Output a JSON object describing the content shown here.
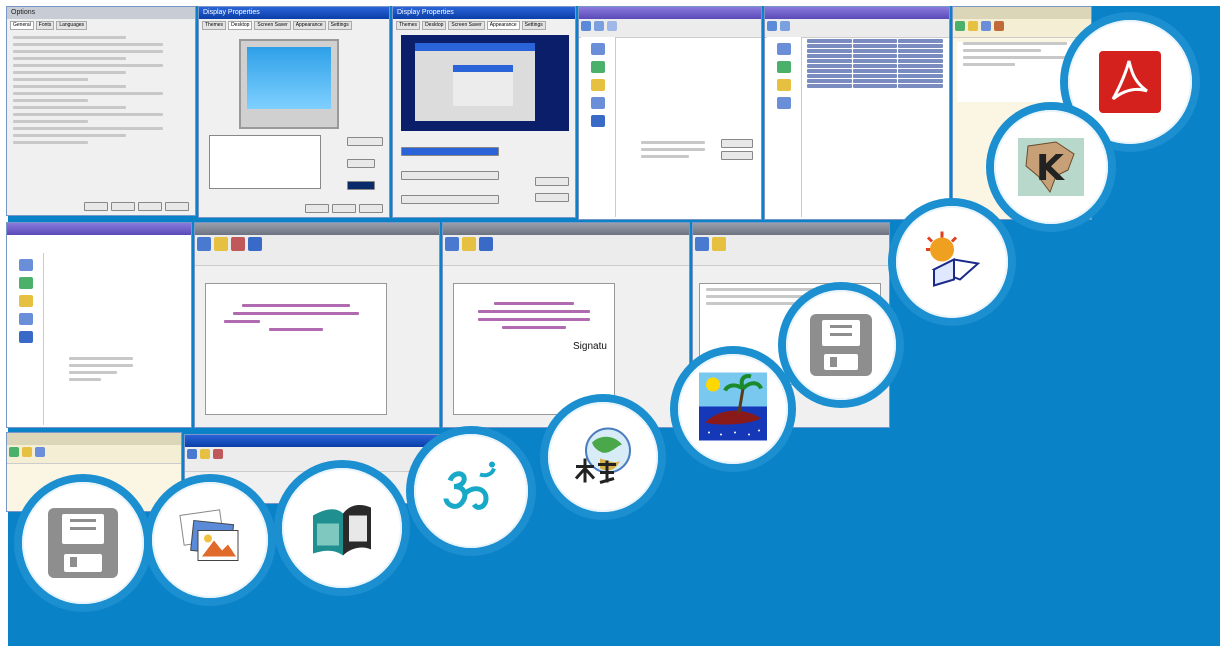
{
  "banner": {
    "background_color": "#0a82c8",
    "circle_color": "#1b8fd0"
  },
  "screenshots": [
    {
      "title": "Options",
      "tabs": [
        "General",
        "Fonts",
        "Languages"
      ]
    },
    {
      "title": "Display Properties",
      "tabs": [
        "Themes",
        "Desktop",
        "Screen Saver",
        "Appearance",
        "Settings"
      ]
    },
    {
      "title": "Display Properties",
      "tabs": [
        "Themes",
        "Desktop",
        "Screen Saver",
        "Appearance",
        "Settings"
      ]
    },
    {
      "title": "",
      "tabs": []
    },
    {
      "title": "",
      "tabs": []
    },
    {
      "title": "",
      "tabs": []
    },
    {
      "title": "",
      "tabs": []
    },
    {
      "title": "",
      "tabs": []
    },
    {
      "title": "",
      "tabs": []
    },
    {
      "title": "",
      "tabs": []
    },
    {
      "title": "",
      "tabs": []
    },
    {
      "title": "",
      "tabs": []
    }
  ],
  "screen_text": {
    "signatu": "Signatu"
  },
  "app_icons": [
    {
      "name": "adobe-pdf-icon",
      "color": "#d4211d"
    },
    {
      "name": "kompozer-k-icon",
      "color": "#2a2a2a"
    },
    {
      "name": "open-book-sun-icon",
      "color": "#f2a400"
    },
    {
      "name": "floppy-disk-icon",
      "color": "#8e8e8e"
    },
    {
      "name": "palm-island-icon",
      "color": "#1438b8"
    },
    {
      "name": "kanji-globe-icon",
      "color": "#3a7cc0"
    },
    {
      "name": "om-symbol-icon",
      "color": "#18a8c8"
    },
    {
      "name": "photo-book-icon",
      "color": "#1f8f8f"
    },
    {
      "name": "photo-stack-icon",
      "color": "#e06a2a"
    },
    {
      "name": "floppy-disk-icon",
      "color": "#8e8e8e"
    }
  ]
}
